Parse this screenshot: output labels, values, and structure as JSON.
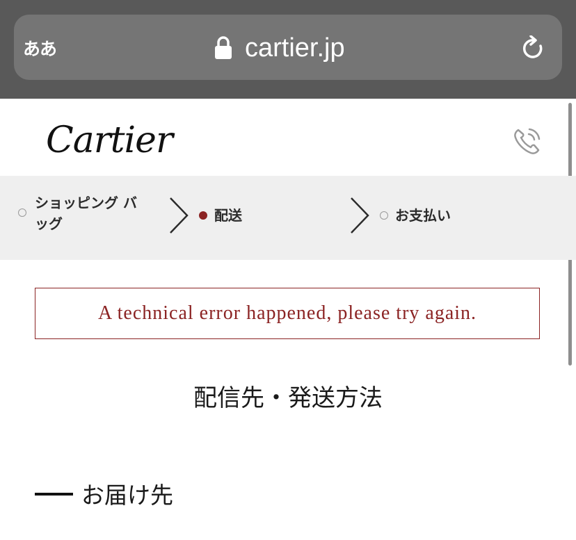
{
  "browser": {
    "text_size_label": "ああ",
    "url": "cartier.jp"
  },
  "site": {
    "logo": "Cartier"
  },
  "steps": [
    {
      "label_line1": "ショッピング バ",
      "label_line2": "ッグ",
      "state": "inactive"
    },
    {
      "label_line1": "配送",
      "state": "active"
    },
    {
      "label_line1": "お支払い",
      "state": "inactive"
    }
  ],
  "error": {
    "message": "A technical error happened, please try again."
  },
  "main": {
    "title": "配信先・発送方法",
    "section_heading": "お届け先"
  },
  "colors": {
    "accent": "#8b2323",
    "chrome": "#595959",
    "steps_bg": "#efefef"
  },
  "icons": [
    "lock-icon",
    "reload-icon",
    "phone-icon",
    "chevron-right-icon"
  ]
}
